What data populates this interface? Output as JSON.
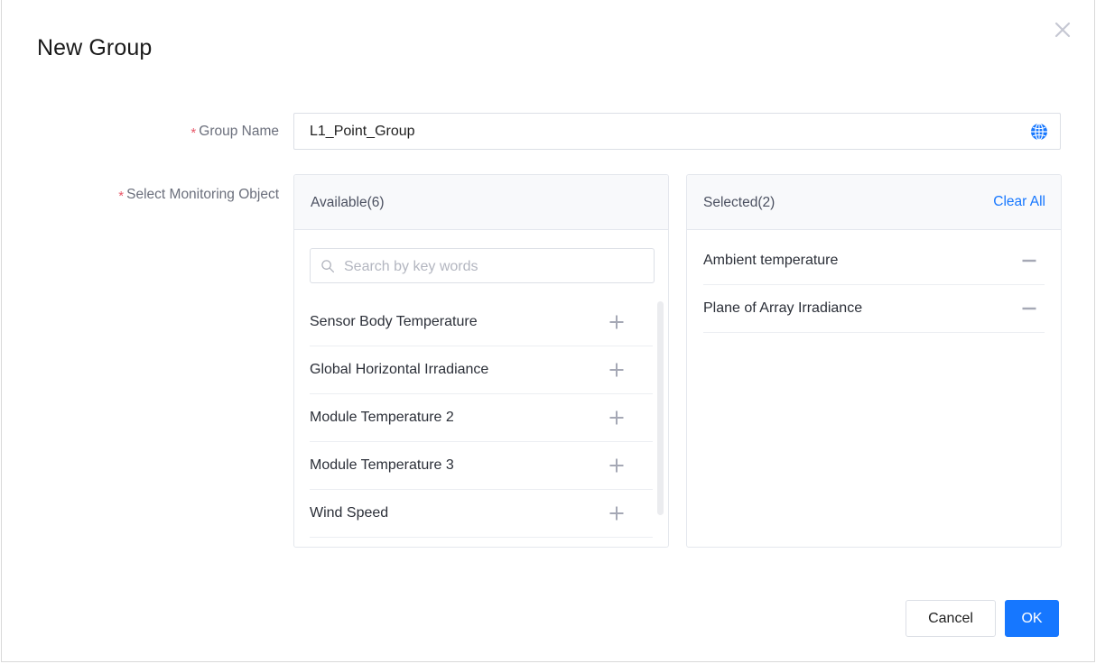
{
  "dialog": {
    "title": "New Group",
    "close_icon": "close-icon"
  },
  "form": {
    "group_name": {
      "label": "Group Name",
      "required_mark": "*",
      "value": "L1_Point_Group",
      "placeholder": "",
      "trailing_icon": "globe-icon"
    },
    "select_monitoring_object": {
      "label": "Select Monitoring Object",
      "required_mark": "*"
    }
  },
  "available_panel": {
    "title": "Available(6)",
    "search": {
      "placeholder": "Search by key words",
      "value": "",
      "icon": "search-icon"
    },
    "items": [
      {
        "label": "Sensor Body Temperature",
        "action_icon": "plus-icon"
      },
      {
        "label": "Global Horizontal Irradiance",
        "action_icon": "plus-icon"
      },
      {
        "label": "Module Temperature 2",
        "action_icon": "plus-icon"
      },
      {
        "label": "Module Temperature 3",
        "action_icon": "plus-icon"
      },
      {
        "label": "Wind Speed",
        "action_icon": "plus-icon"
      },
      {
        "label": "",
        "action_icon": "plus-icon"
      }
    ]
  },
  "selected_panel": {
    "title": "Selected(2)",
    "clear_all": "Clear All",
    "items": [
      {
        "label": "Ambient temperature",
        "action_icon": "minus-icon"
      },
      {
        "label": "Plane of Array Irradiance",
        "action_icon": "minus-icon"
      }
    ]
  },
  "footer": {
    "cancel": "Cancel",
    "ok": "OK"
  },
  "colors": {
    "accent_blue": "#1677ff",
    "required_red": "#e8596a",
    "label_gray": "#6b6f7c",
    "panel_header_bg": "#f8f9fb",
    "border": "#e4e7ed",
    "icon_gray": "#a5a8b5"
  }
}
